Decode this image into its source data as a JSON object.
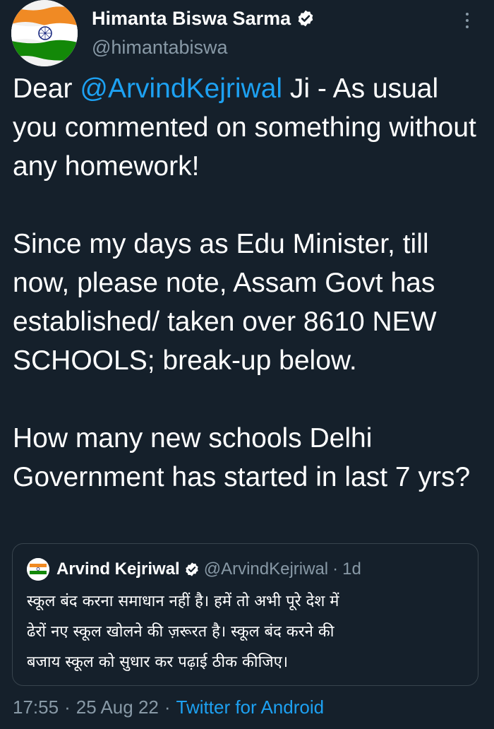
{
  "author": {
    "display_name": "Himanta Biswa Sarma",
    "handle": "@himantabiswa",
    "avatar_icon": "india-flag-icon",
    "verified_icon": "verified-badge-icon"
  },
  "tweet": {
    "lines_p1_prefix": "Dear ",
    "mention": "@ArvindKejriwal",
    "lines_p1_suffix": " Ji - As usual you commented on something without any homework!",
    "paragraph2": "Since my days as Edu Minister, till now, please note, Assam Govt has established/ taken over 8610 NEW SCHOOLS; break-up below.",
    "paragraph3": "How many new schools Delhi Government has started in last 7 yrs?"
  },
  "quoted_tweet": {
    "display_name": "Arvind Kejriwal",
    "handle": "@ArvindKejriwal",
    "separator": "·",
    "time": "1d",
    "text_line1": "स्कूल बंद करना समाधान नहीं है। हमें तो अभी पूरे देश में",
    "text_line2": "ढेरों नए स्कूल खोलने की ज़रूरत है। स्कूल बंद करने की",
    "text_line3": "बजाय स्कूल को सुधार कर पढ़ाई ठीक कीजिए।"
  },
  "meta": {
    "time": "17:55",
    "sep1": "·",
    "date": "25 Aug 22",
    "sep2": "·",
    "source": "Twitter for Android"
  },
  "colors": {
    "background": "#15202b",
    "accent": "#1da1f2",
    "muted": "#8899a6",
    "border": "#38444d"
  }
}
